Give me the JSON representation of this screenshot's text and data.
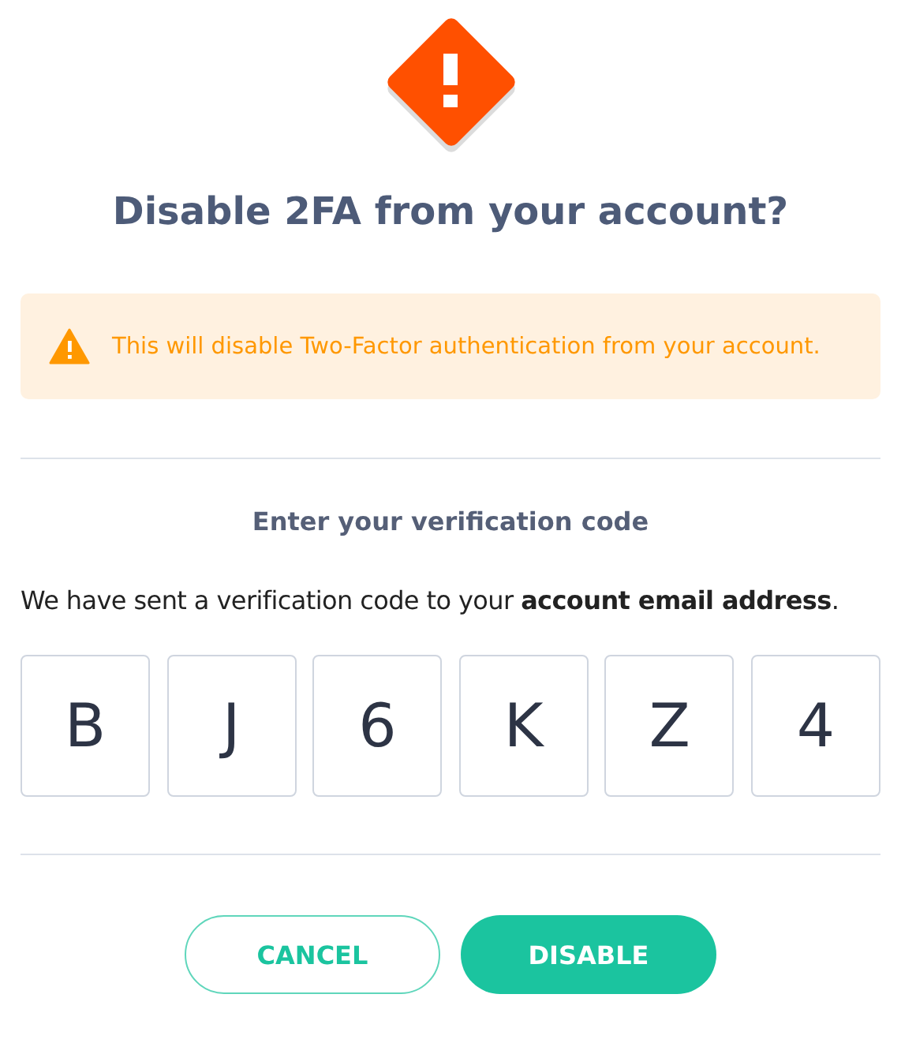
{
  "title": "Disable 2FA from your account?",
  "alert": {
    "text": "This will disable Two-Factor authentication from your account."
  },
  "subtitle": "Enter your verification code",
  "message": "We have sent a verification code to your **account email address**.",
  "code": [
    "B",
    "J",
    "6",
    "K",
    "Z",
    "4"
  ],
  "buttons": [
    {
      "label": "CANCEL",
      "kind": "outline"
    },
    {
      "label": "DISABLE",
      "kind": "primary"
    }
  ]
}
